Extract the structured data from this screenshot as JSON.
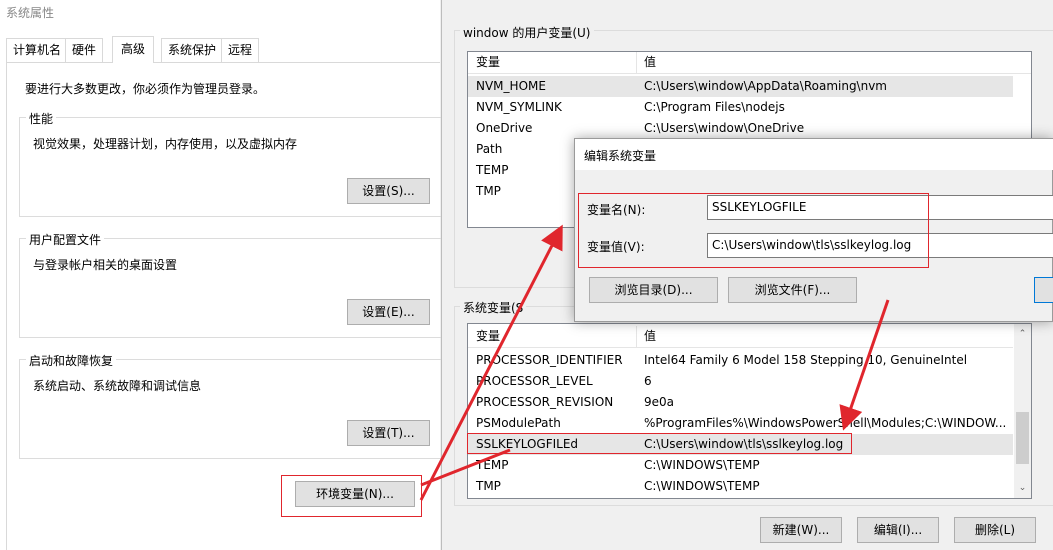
{
  "left_window": {
    "title": "系统属性",
    "tabs": [
      "计算机名",
      "硬件",
      "高级",
      "系统保护",
      "远程"
    ],
    "admin_notice": "要进行大多数更改，你必须作为管理员登录。",
    "performance": {
      "title": "性能",
      "desc": "视觉效果，处理器计划，内存使用，以及虚拟内存",
      "button": "设置(S)..."
    },
    "user_profiles": {
      "title": "用户配置文件",
      "desc": "与登录帐户相关的桌面设置",
      "button": "设置(E)..."
    },
    "startup": {
      "title": "启动和故障恢复",
      "desc": "系统启动、系统故障和调试信息",
      "button": "设置(T)..."
    },
    "env_button": "环境变量(N)..."
  },
  "env_window": {
    "user_vars_title": "window 的用户变量(U)",
    "col_var": "变量",
    "col_val": "值",
    "user_vars": [
      {
        "name": "NVM_HOME",
        "value": "C:\\Users\\window\\AppData\\Roaming\\nvm"
      },
      {
        "name": "NVM_SYMLINK",
        "value": "C:\\Program Files\\nodejs"
      },
      {
        "name": "OneDrive",
        "value": "C:\\Users\\window\\OneDrive"
      },
      {
        "name": "Path",
        "value": ""
      },
      {
        "name": "TEMP",
        "value": ""
      },
      {
        "name": "TMP",
        "value": ""
      }
    ],
    "system_vars_title": "系统变量(S",
    "system_vars": [
      {
        "name": "PROCESSOR_IDENTIFIER",
        "value": "Intel64 Family 6 Model 158 Stepping 10, GenuineIntel"
      },
      {
        "name": "PROCESSOR_LEVEL",
        "value": "6"
      },
      {
        "name": "PROCESSOR_REVISION",
        "value": "9e0a"
      },
      {
        "name": "PSModulePath",
        "value": "%ProgramFiles%\\WindowsPowerShell\\Modules;C:\\WINDOW..."
      },
      {
        "name": "SSLKEYLOGFILEd",
        "value": "C:\\Users\\window\\tls\\sslkeylog.log"
      },
      {
        "name": "TEMP",
        "value": "C:\\WINDOWS\\TEMP"
      },
      {
        "name": "TMP",
        "value": "C:\\WINDOWS\\TEMP"
      }
    ],
    "btn_new": "新建(W)...",
    "btn_edit": "编辑(I)...",
    "btn_delete": "删除(L)"
  },
  "edit_dialog": {
    "title": "编辑系统变量",
    "name_label": "变量名(N):",
    "name_value": "SSLKEYLOGFILE",
    "value_label": "变量值(V):",
    "value_value": "C:\\Users\\window\\tls\\sslkeylog.log",
    "btn_browse_dir": "浏览目录(D)...",
    "btn_browse_file": "浏览文件(F)..."
  },
  "colors": {
    "annotation_red": "#e0262d",
    "selected_row": "#e6e6e6"
  }
}
